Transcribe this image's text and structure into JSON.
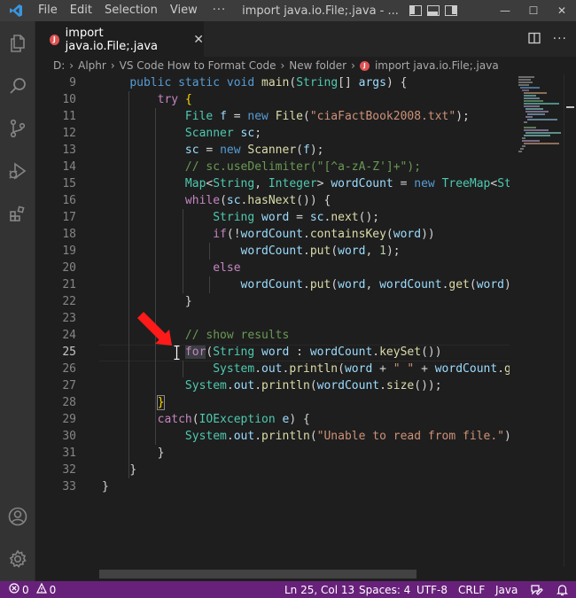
{
  "window": {
    "menu": [
      "File",
      "Edit",
      "Selection",
      "View"
    ],
    "more": "···",
    "title": "import java.io.File;.java - ...",
    "controls": [
      "minimize",
      "maximize",
      "close"
    ]
  },
  "tab": {
    "badge": "J",
    "label": "import java.io.File;.java"
  },
  "breadcrumb": {
    "items": [
      "D:",
      "Alphr",
      "VS Code How to Format Code",
      "New folder"
    ],
    "file_badge": "J",
    "file": "import java.io.File;.java"
  },
  "editor": {
    "active_line": "25",
    "line_numbers": [
      "9",
      "10",
      "11",
      "12",
      "13",
      "14",
      "15",
      "16",
      "17",
      "18",
      "19",
      "20",
      "21",
      "22",
      "23",
      "24",
      "25",
      "26",
      "27",
      "28",
      "29",
      "30",
      "31",
      "32",
      "33"
    ]
  },
  "statusbar": {
    "errors": "0",
    "warnings": "0",
    "position": "Ln 25, Col 13",
    "spaces": "Spaces: 4",
    "encoding": "UTF-8",
    "eol": "CRLF",
    "language": "Java"
  },
  "colors": {
    "statusbar": "#68217a",
    "keyword": "#569cd6",
    "control": "#c586c0",
    "type": "#4ec9b0",
    "function": "#dcdcaa",
    "variable": "#9cdcfe",
    "string": "#ce9178",
    "comment": "#6a9955",
    "arrow": "#ff1a1a"
  },
  "icons": [
    "vscode-logo-icon",
    "explorer-icon",
    "search-icon",
    "source-control-icon",
    "run-debug-icon",
    "extensions-icon",
    "account-icon",
    "settings-gear-icon",
    "split-editor-icon",
    "more-actions-icon",
    "error-icon",
    "warning-icon",
    "feedback-icon",
    "bell-icon",
    "red-arrow-icon"
  ]
}
